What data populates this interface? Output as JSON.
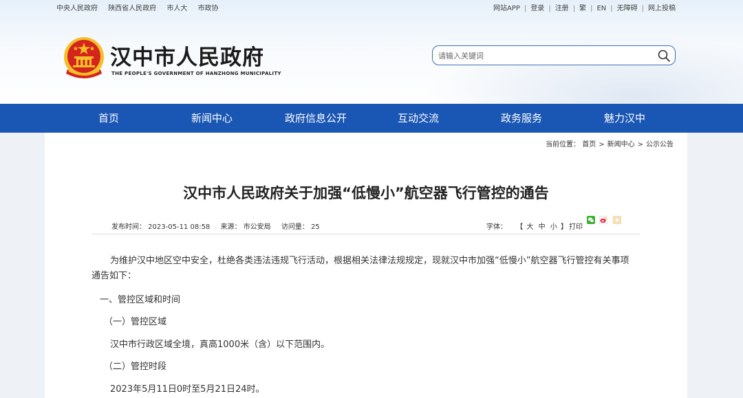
{
  "top_links_left": [
    "中央人民政府",
    "陕西省人民政府",
    "市人大",
    "市政协"
  ],
  "top_links_right": [
    "网站APP",
    "登录",
    "注册",
    "繁",
    "EN",
    "无障碍",
    "网上投稿"
  ],
  "site": {
    "title": "汉中市人民政府",
    "subtitle": "THE PEOPLE'S GOVERNMENT OF HANZHONG MUNICIPALITY"
  },
  "search": {
    "placeholder": "请输入关键词"
  },
  "nav": [
    "首页",
    "新闻中心",
    "政府信息公开",
    "互动交流",
    "政务服务",
    "魅力汉中"
  ],
  "breadcrumb": {
    "label": "当前位置：",
    "items": [
      "首页",
      "新闻中心",
      "公示公告"
    ]
  },
  "article": {
    "title": "汉中市人民政府关于加强“低慢小”航空器飞行管控的通告",
    "publish_time": "发布时间：  2023-05-11 08:58",
    "source": "来源：  市公安局",
    "views": "访问量：  25",
    "font_label": "字体：",
    "font_open": "【",
    "font_large": "大",
    "font_medium": "中",
    "font_small": "小",
    "font_close": "】",
    "print": "打印",
    "paragraphs": [
      "为维护汉中地区空中安全，杜绝各类违法违规飞行活动，根据相关法律法规规定，现就汉中市加强“低慢小”航空器飞行管控有关事项",
      "通告如下：",
      "一、管控区域和时间",
      "（一）管控区域",
      "汉中市行政区域全境，真高1000米（含）以下范围内。",
      "（二）管控时段",
      "2023年5月11日0时至5月21日24时。"
    ]
  },
  "colors": {
    "nav_bg": "#1a56b3",
    "emblem_red": "#d4241c",
    "emblem_gold": "#f3c02a"
  },
  "icons": [
    "search-icon",
    "wechat-icon",
    "weibo-icon",
    "qzone-icon"
  ]
}
